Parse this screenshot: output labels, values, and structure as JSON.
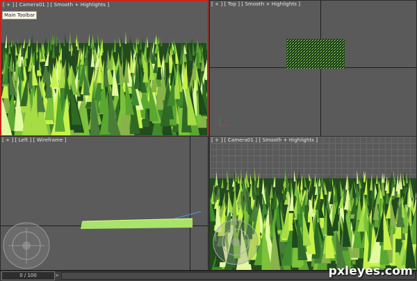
{
  "viewports": {
    "top_left": {
      "label": "[ + ] [ Camera01 ] [ Smooth + Highlights ]",
      "tooltip": "Main Toolbar"
    },
    "top_right": {
      "label": "[ + ] [ Top ] [ Smooth + Highlights ]"
    },
    "bottom_left": {
      "label": "[ + ] [ Left ] [ Wireframe ]"
    },
    "bottom_right": {
      "label": "[ + ] [ Camera01 ] [ Smooth + Highlights ]"
    }
  },
  "timeline": {
    "frame": "0 / 100",
    "arrow": ">"
  },
  "watermark": "pxleyes.com",
  "colors": {
    "active_border": "#c8231f",
    "grass_light": "#c8f24a",
    "grass_mid": "#5aa82f",
    "grass_dark": "#1e4a1c"
  }
}
